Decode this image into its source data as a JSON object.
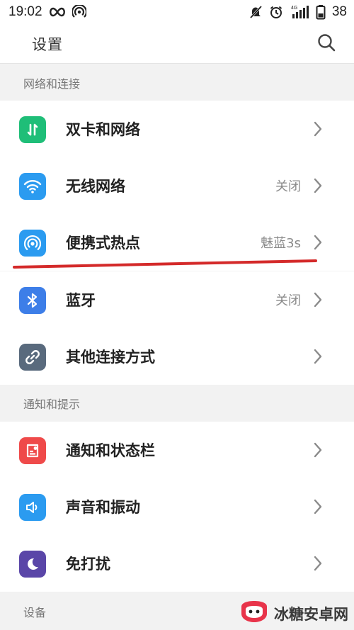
{
  "status_bar": {
    "time": "19:02",
    "battery": "38",
    "network_type": "4G",
    "icons": [
      "infinity-icon",
      "hotspot-status-icon",
      "mute-icon",
      "alarm-icon",
      "signal-icon",
      "battery-icon"
    ]
  },
  "header": {
    "title": "设置",
    "search_icon": "search-icon"
  },
  "sections": [
    {
      "title": "网络和连接",
      "items": [
        {
          "label": "双卡和网络",
          "value": "",
          "icon": "dual-sim-icon",
          "color": "#1fbe78"
        },
        {
          "label": "无线网络",
          "value": "关闭",
          "icon": "wifi-icon",
          "color": "#2b9bf0"
        },
        {
          "label": "便携式热点",
          "value": "魅蓝3s",
          "icon": "hotspot-icon",
          "color": "#2b9bf0"
        },
        {
          "label": "蓝牙",
          "value": "关闭",
          "icon": "bluetooth-icon",
          "color": "#3d7ee8"
        },
        {
          "label": "其他连接方式",
          "value": "",
          "icon": "link-icon",
          "color": "#596a7d"
        }
      ]
    },
    {
      "title": "通知和提示",
      "items": [
        {
          "label": "通知和状态栏",
          "value": "",
          "icon": "notification-icon",
          "color": "#ef4a4a"
        },
        {
          "label": "声音和振动",
          "value": "",
          "icon": "sound-icon",
          "color": "#2b9bf0"
        },
        {
          "label": "免打扰",
          "value": "",
          "icon": "moon-icon",
          "color": "#5a46a8"
        }
      ]
    },
    {
      "title": "设备",
      "items": []
    }
  ],
  "watermark": {
    "text": "冰糖安卓网"
  },
  "colors": {
    "annotation_red": "#d42a2a",
    "background": "#f2f2f2"
  }
}
